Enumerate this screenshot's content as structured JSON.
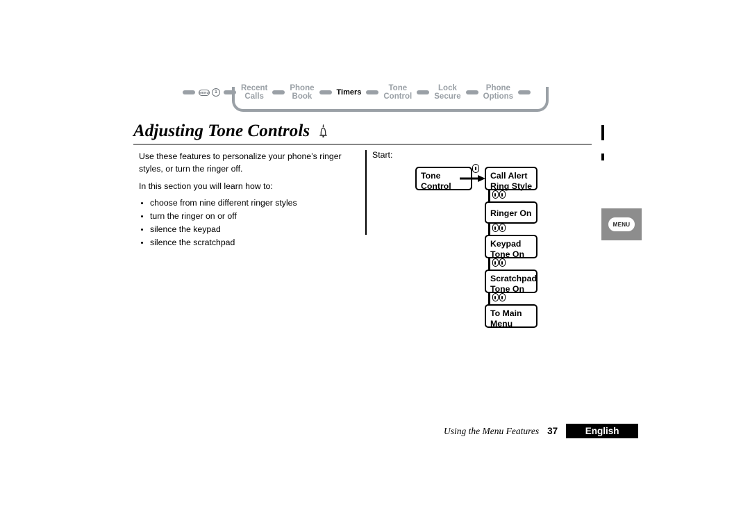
{
  "nav": {
    "menu_key_label": "MENU",
    "number_key_label": "1",
    "items": [
      {
        "label": "Recent\nCalls",
        "current": false
      },
      {
        "label": "Phone\nBook",
        "current": false
      },
      {
        "label": "Timers",
        "current": true
      },
      {
        "label": "Tone\nControl",
        "current": false
      },
      {
        "label": "Lock\nSecure",
        "current": false
      },
      {
        "label": "Phone\nOptions",
        "current": false
      }
    ],
    "accent_gray": "#9aa0a6",
    "current_color": "#000000"
  },
  "title": {
    "text": "Adjusting Tone Controls",
    "icon": "bell-icon"
  },
  "copy": {
    "intro": "Use these features to personalize your phone’s ringer styles, or turn the ringer off.",
    "lead_in": "In this section you will learn how to:",
    "bullets": [
      "choose from nine different ringer styles",
      "turn the ringer on or off",
      "silence the keypad",
      "silence the scratchpad"
    ]
  },
  "flow": {
    "start_label": "Start:",
    "start_box": "Tone\nControl",
    "menu_key_glyph": "menu-key-icon",
    "scroll_key_glyph": "scroll-key-icon",
    "steps": [
      "Call Alert\nRing Style",
      "Ringer On",
      "Keypad\nTone On",
      "Scratchpad\nTone On",
      "To Main\nMenu"
    ]
  },
  "margin": {
    "menu_button_label": "MENU",
    "panel_color": "#8d8d8d"
  },
  "footer": {
    "section": "Using the Menu Features",
    "page": "37",
    "language": "English"
  }
}
